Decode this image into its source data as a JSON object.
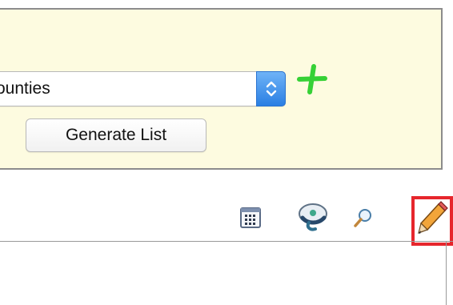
{
  "form": {
    "select_value": "ounties",
    "generate_button_label": "Generate List",
    "add_icon": "plus-icon",
    "stepper_icon": "chevron-up-down-icon"
  },
  "toolbar": {
    "items": [
      {
        "icon": "table-icon"
      },
      {
        "icon": "cloud-icon"
      },
      {
        "icon": "search-icon"
      },
      {
        "icon": "pencil-icon",
        "highlighted": true
      }
    ]
  },
  "colors": {
    "panel_background": "#fdfbe0",
    "panel_border": "#8c8c8c",
    "stepper_blue": "#2a7fe3",
    "add_green": "#36d136",
    "highlight_red": "#e6262c"
  }
}
